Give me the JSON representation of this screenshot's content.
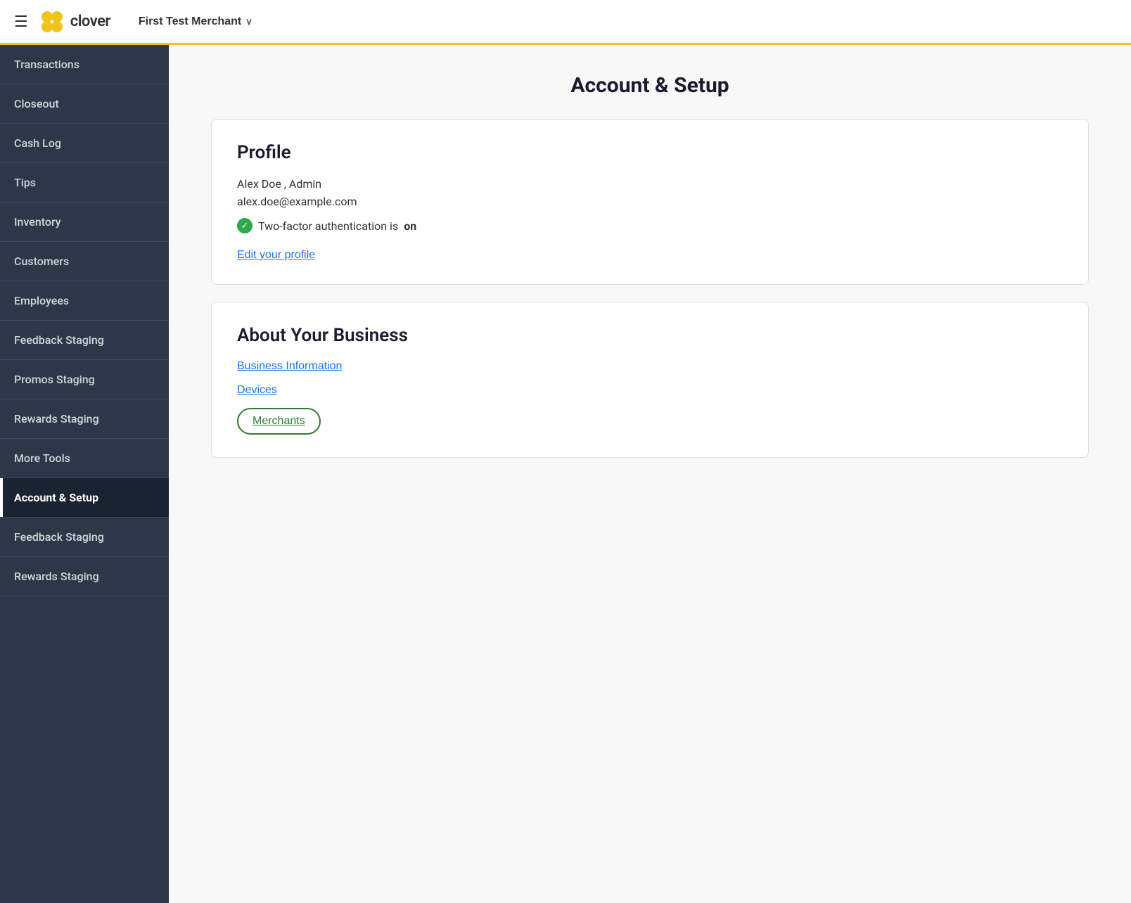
{
  "header": {
    "hamburger_label": "☰",
    "logo_text": "clover",
    "merchant_name": "First Test Merchant",
    "chevron": "∨"
  },
  "sidebar": {
    "items": [
      {
        "id": "transactions",
        "label": "Transactions",
        "active": false,
        "truncated": false
      },
      {
        "id": "closeout",
        "label": "Closeout",
        "active": false,
        "truncated": false
      },
      {
        "id": "cash-log",
        "label": "Cash Log",
        "active": false,
        "truncated": false
      },
      {
        "id": "tips",
        "label": "Tips",
        "active": false,
        "truncated": false
      },
      {
        "id": "inventory",
        "label": "Inventory",
        "active": false,
        "truncated": false
      },
      {
        "id": "customers",
        "label": "Customers",
        "active": false,
        "truncated": false
      },
      {
        "id": "employees",
        "label": "Employees",
        "active": false,
        "truncated": false
      },
      {
        "id": "feedback-staging",
        "label": "Feedback Staging",
        "active": false,
        "truncated": false
      },
      {
        "id": "promos-staging",
        "label": "Promos Staging",
        "active": false,
        "truncated": false
      },
      {
        "id": "rewards-staging",
        "label": "Rewards Staging",
        "active": false,
        "truncated": false
      },
      {
        "id": "more-tools",
        "label": "More Tools",
        "active": false,
        "truncated": false
      },
      {
        "id": "account-setup",
        "label": "Account & Setup",
        "active": true,
        "truncated": false
      },
      {
        "id": "feedback-staging-2",
        "label": "Feedback Staging",
        "active": false,
        "truncated": false
      },
      {
        "id": "rewards-staging-2",
        "label": "Rewards Staging",
        "active": false,
        "truncated": false
      }
    ]
  },
  "main": {
    "page_title": "Account & Setup",
    "profile_card": {
      "title": "Profile",
      "name": "Alex Doe , Admin",
      "email": "alex.doe@example.com",
      "tfa_text": "Two-factor authentication is ",
      "tfa_status": "on",
      "edit_link": "Edit your profile"
    },
    "business_card": {
      "title": "About Your Business",
      "links": [
        {
          "id": "business-info",
          "label": "Business Information"
        },
        {
          "id": "devices",
          "label": "Devices"
        }
      ],
      "merchants_button": "Merchants"
    }
  }
}
